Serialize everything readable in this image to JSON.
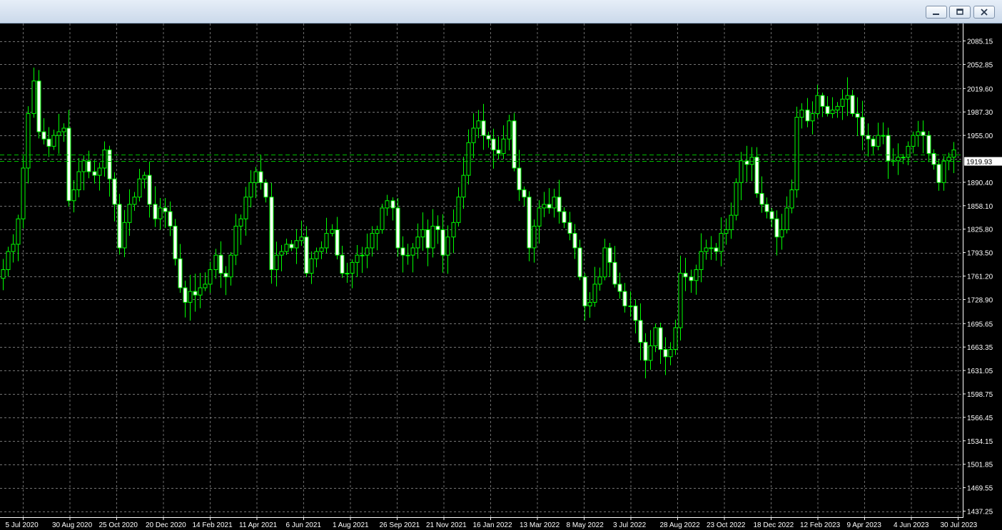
{
  "window": {
    "minimize_icon": "minimize-icon",
    "restore_icon": "restore-icon",
    "close_icon": "close-icon"
  },
  "chart_data": {
    "type": "candlestick",
    "colors": {
      "background": "#000000",
      "grid": "#9a9a9a",
      "candle": "#00ff00",
      "bull_body": "#000000",
      "bear_body": "#ffffff",
      "axis_text": "#ffffff"
    },
    "grid": true,
    "ylim": [
      1437.25,
      2100.0
    ],
    "y_ticks": [
      "2085.15",
      "2052.85",
      "2019.60",
      "1987.30",
      "1955.00",
      "1919.93",
      "1890.40",
      "1858.10",
      "1825.80",
      "1793.50",
      "1761.20",
      "1728.90",
      "1695.65",
      "1663.35",
      "1631.05",
      "1598.75",
      "1566.45",
      "1534.15",
      "1501.85",
      "1469.55",
      "1437.25"
    ],
    "y_tick_values": [
      2085.15,
      2052.85,
      2019.6,
      1987.3,
      1955.0,
      1922.7,
      1890.4,
      1858.1,
      1825.8,
      1793.5,
      1761.2,
      1728.9,
      1695.65,
      1663.35,
      1631.05,
      1598.75,
      1566.45,
      1534.15,
      1501.85,
      1469.55,
      1437.25
    ],
    "current_price": "1919.93",
    "current_price_value": 1919.93,
    "x_labels": [
      "5 Jul 2020",
      "30 Aug 2020",
      "25 Oct 2020",
      "20 Dec 2020",
      "14 Feb 2021",
      "11 Apr 2021",
      "6 Jun 2021",
      "1 Aug 2021",
      "26 Sep 2021",
      "21 Nov 2021",
      "16 Jan 2022",
      "13 Mar 2022",
      "8 May 2022",
      "3 Jul 2022",
      "28 Aug 2022",
      "23 Oct 2022",
      "18 Dec 2022",
      "12 Feb 2023",
      "9 Apr 2023",
      "4 Jun 2023",
      "30 Jul 2023"
    ],
    "close_series": [
      1770,
      1795,
      1805,
      1840,
      1910,
      1985,
      2030,
      1960,
      1950,
      1940,
      1955,
      1960,
      1965,
      1865,
      1880,
      1905,
      1920,
      1905,
      1900,
      1910,
      1935,
      1895,
      1860,
      1800,
      1835,
      1860,
      1870,
      1895,
      1900,
      1860,
      1840,
      1855,
      1850,
      1830,
      1785,
      1745,
      1725,
      1740,
      1735,
      1745,
      1750,
      1770,
      1790,
      1765,
      1760,
      1790,
      1830,
      1840,
      1870,
      1890,
      1905,
      1890,
      1870,
      1770,
      1790,
      1795,
      1805,
      1800,
      1810,
      1815,
      1765,
      1785,
      1795,
      1800,
      1820,
      1825,
      1790,
      1765,
      1765,
      1780,
      1790,
      1790,
      1800,
      1820,
      1825,
      1855,
      1865,
      1855,
      1800,
      1790,
      1790,
      1800,
      1815,
      1825,
      1800,
      1830,
      1825,
      1790,
      1815,
      1835,
      1870,
      1900,
      1945,
      1965,
      1975,
      1955,
      1950,
      1935,
      1930,
      1950,
      1975,
      1910,
      1880,
      1870,
      1800,
      1830,
      1855,
      1860,
      1855,
      1870,
      1850,
      1835,
      1820,
      1800,
      1760,
      1720,
      1725,
      1750,
      1760,
      1800,
      1780,
      1750,
      1740,
      1720,
      1720,
      1700,
      1670,
      1645,
      1665,
      1690,
      1660,
      1650,
      1660,
      1690,
      1765,
      1760,
      1755,
      1770,
      1795,
      1800,
      1800,
      1795,
      1820,
      1825,
      1845,
      1890,
      1920,
      1915,
      1925,
      1875,
      1860,
      1850,
      1840,
      1815,
      1825,
      1855,
      1880,
      1980,
      1990,
      1975,
      1985,
      2010,
      1995,
      1985,
      1990,
      1995,
      2005,
      2010,
      1985,
      1980,
      1955,
      1950,
      1940,
      1955,
      1955,
      1920,
      1920,
      1925,
      1925,
      1940,
      1955,
      1960,
      1955,
      1930,
      1915,
      1890,
      1920,
      1925,
      1935
    ]
  }
}
